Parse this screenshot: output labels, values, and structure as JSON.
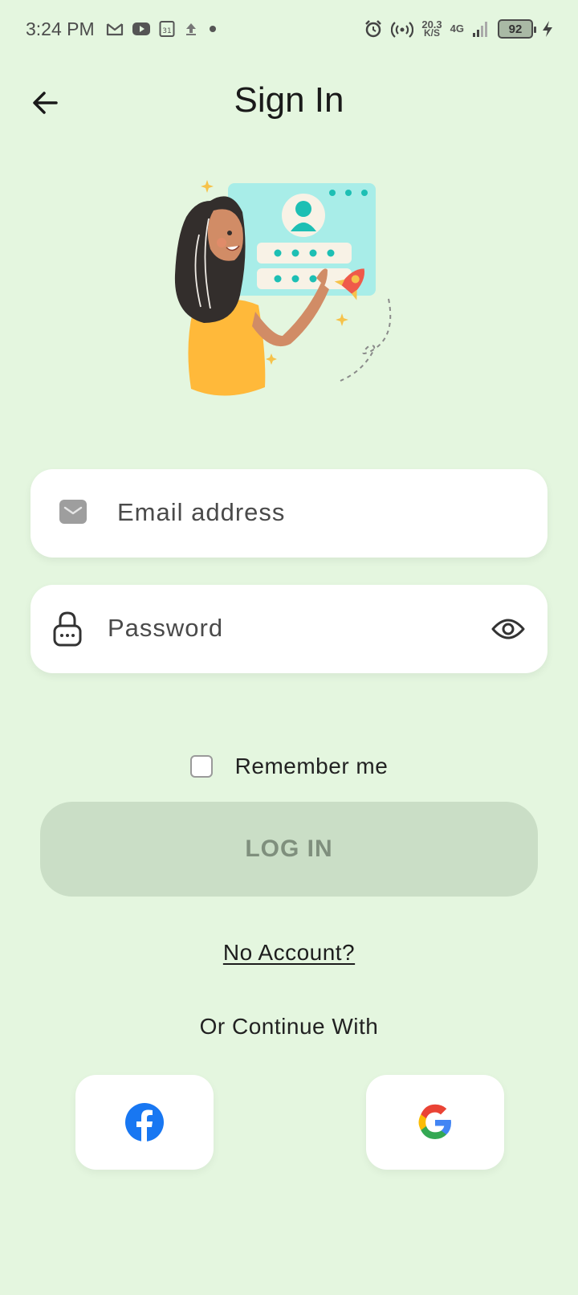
{
  "status_bar": {
    "time": "3:24 PM",
    "speed_value": "20.3",
    "speed_unit": "K/S",
    "network": "4G",
    "battery": "92",
    "icons": [
      "gmail-icon",
      "youtube-icon",
      "calendar-icon",
      "upload-icon",
      "dot-icon",
      "alarm-icon",
      "hotspot-icon",
      "signal-icon",
      "charging-icon"
    ]
  },
  "header": {
    "title": "Sign In",
    "back_icon": "arrow-left-icon"
  },
  "form": {
    "email": {
      "placeholder": "Email address",
      "icon": "envelope-icon"
    },
    "password": {
      "placeholder": "Password",
      "icon": "lock-icon",
      "toggle_icon": "eye-icon"
    },
    "remember_label": "Remember me",
    "remember_checked": false,
    "login_label": "LOG IN"
  },
  "links": {
    "no_account": "No Account?",
    "continue_with": "Or Continue With"
  },
  "social": {
    "facebook_icon": "facebook-icon",
    "google_icon": "google-icon"
  },
  "colors": {
    "background": "#e4f6df",
    "login_button": "#cadec6",
    "login_text": "#7f8f7d",
    "facebook": "#1877f2"
  }
}
